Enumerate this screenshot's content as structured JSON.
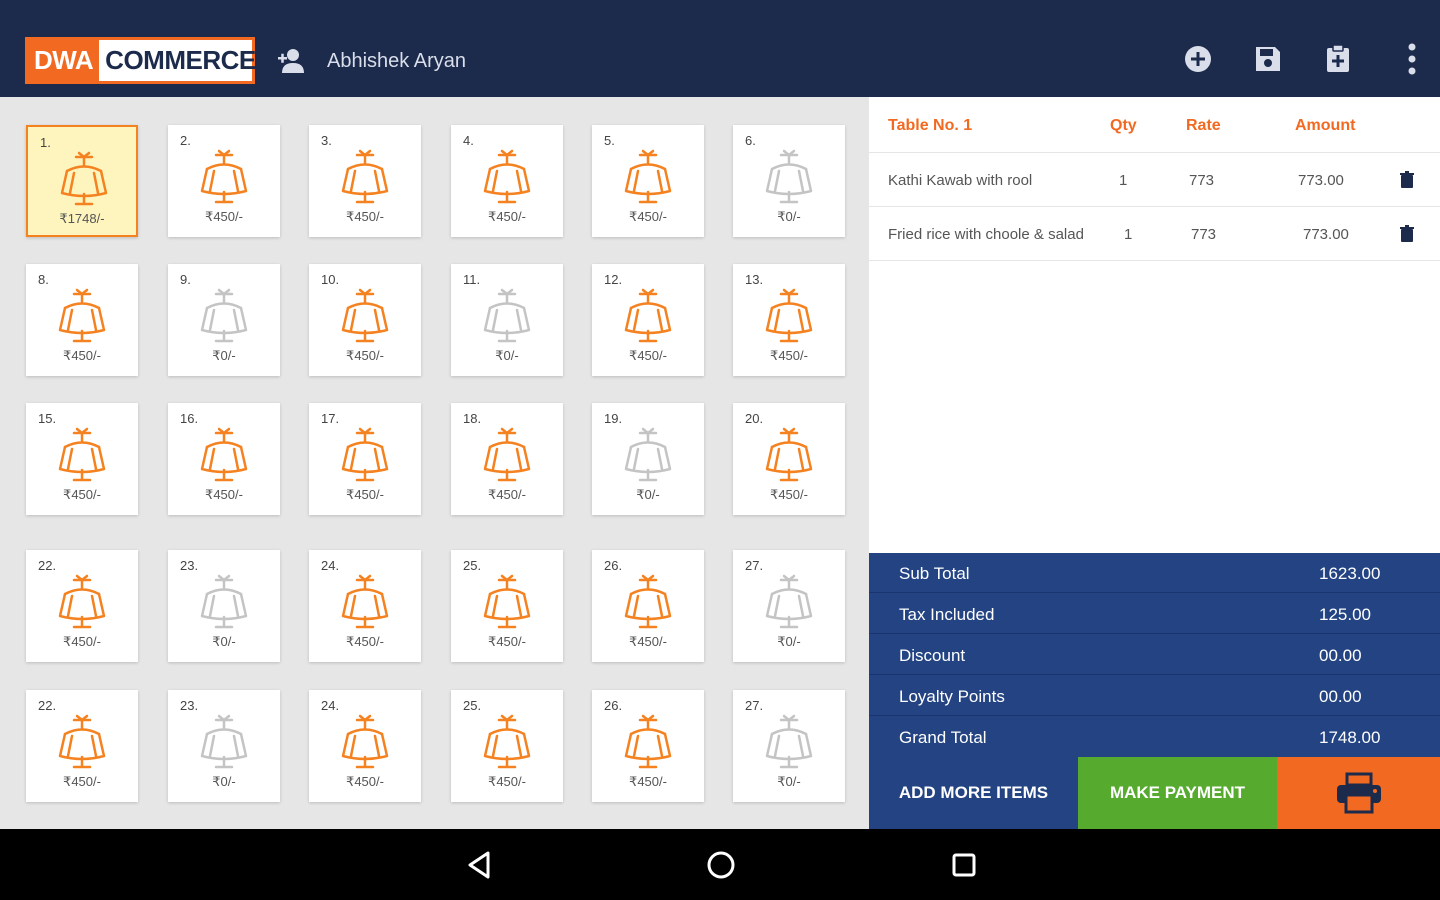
{
  "header": {
    "logo_part1": "DWA",
    "logo_part2": "COMMERCE",
    "user_name": "Abhishek Aryan",
    "icons": [
      "add-user-icon",
      "add-circle-icon",
      "save-icon",
      "clipboard-icon",
      "more-vert-icon"
    ]
  },
  "tables": [
    {
      "num": "1.",
      "amount": "₹1748/-",
      "status": "selected"
    },
    {
      "num": "2.",
      "amount": "₹450/-",
      "status": "occupied"
    },
    {
      "num": "3.",
      "amount": "₹450/-",
      "status": "occupied"
    },
    {
      "num": "4.",
      "amount": "₹450/-",
      "status": "occupied"
    },
    {
      "num": "5.",
      "amount": "₹450/-",
      "status": "occupied"
    },
    {
      "num": "6.",
      "amount": "₹0/-",
      "status": "free"
    },
    {
      "num": "8.",
      "amount": "₹450/-",
      "status": "occupied"
    },
    {
      "num": "9.",
      "amount": "₹0/-",
      "status": "free"
    },
    {
      "num": "10.",
      "amount": "₹450/-",
      "status": "occupied"
    },
    {
      "num": "11.",
      "amount": "₹0/-",
      "status": "free"
    },
    {
      "num": "12.",
      "amount": "₹450/-",
      "status": "occupied"
    },
    {
      "num": "13.",
      "amount": "₹450/-",
      "status": "occupied"
    },
    {
      "num": "15.",
      "amount": "₹450/-",
      "status": "occupied"
    },
    {
      "num": "16.",
      "amount": "₹450/-",
      "status": "occupied"
    },
    {
      "num": "17.",
      "amount": "₹450/-",
      "status": "occupied"
    },
    {
      "num": "18.",
      "amount": "₹450/-",
      "status": "occupied"
    },
    {
      "num": "19.",
      "amount": "₹0/-",
      "status": "free"
    },
    {
      "num": "20.",
      "amount": "₹450/-",
      "status": "occupied"
    },
    {
      "num": "22.",
      "amount": "₹450/-",
      "status": "occupied"
    },
    {
      "num": "23.",
      "amount": "₹0/-",
      "status": "free"
    },
    {
      "num": "24.",
      "amount": "₹450/-",
      "status": "occupied"
    },
    {
      "num": "25.",
      "amount": "₹450/-",
      "status": "occupied"
    },
    {
      "num": "26.",
      "amount": "₹450/-",
      "status": "occupied"
    },
    {
      "num": "27.",
      "amount": "₹0/-",
      "status": "free"
    },
    {
      "num": "22.",
      "amount": "₹450/-",
      "status": "occupied"
    },
    {
      "num": "23.",
      "amount": "₹0/-",
      "status": "free"
    },
    {
      "num": "24.",
      "amount": "₹450/-",
      "status": "occupied"
    },
    {
      "num": "25.",
      "amount": "₹450/-",
      "status": "occupied"
    },
    {
      "num": "26.",
      "amount": "₹450/-",
      "status": "occupied"
    },
    {
      "num": "27.",
      "amount": "₹0/-",
      "status": "free"
    }
  ],
  "order": {
    "headers": {
      "table": "Table No. 1",
      "qty": "Qty",
      "rate": "Rate",
      "amount": "Amount"
    },
    "items": [
      {
        "name": "Kathi Kawab with rool",
        "qty": "1",
        "rate": "773",
        "amount": "773.00"
      },
      {
        "name": "Fried rice with choole  & salad",
        "qty": "1",
        "rate": "773",
        "amount": "773.00"
      }
    ]
  },
  "summary": [
    {
      "label": "Sub Total",
      "value": "1623.00"
    },
    {
      "label": "Tax Included",
      "value": "125.00"
    },
    {
      "label": "Discount",
      "value": "00.00"
    },
    {
      "label": "Loyalty Points",
      "value": "00.00"
    },
    {
      "label": "Grand Total",
      "value": "1748.00"
    }
  ],
  "actions": {
    "add_more": "ADD MORE ITEMS",
    "make_payment": "MAKE PAYMENT"
  },
  "colors": {
    "header_bg": "#1c2a4c",
    "accent_orange": "#f26a21",
    "summary_blue": "#234383",
    "pay_green": "#56ab2f",
    "table_occupied": "#f58220",
    "table_free": "#c4c4c4"
  },
  "navbar": {
    "icons": [
      "back-icon",
      "home-icon",
      "recents-icon"
    ]
  }
}
